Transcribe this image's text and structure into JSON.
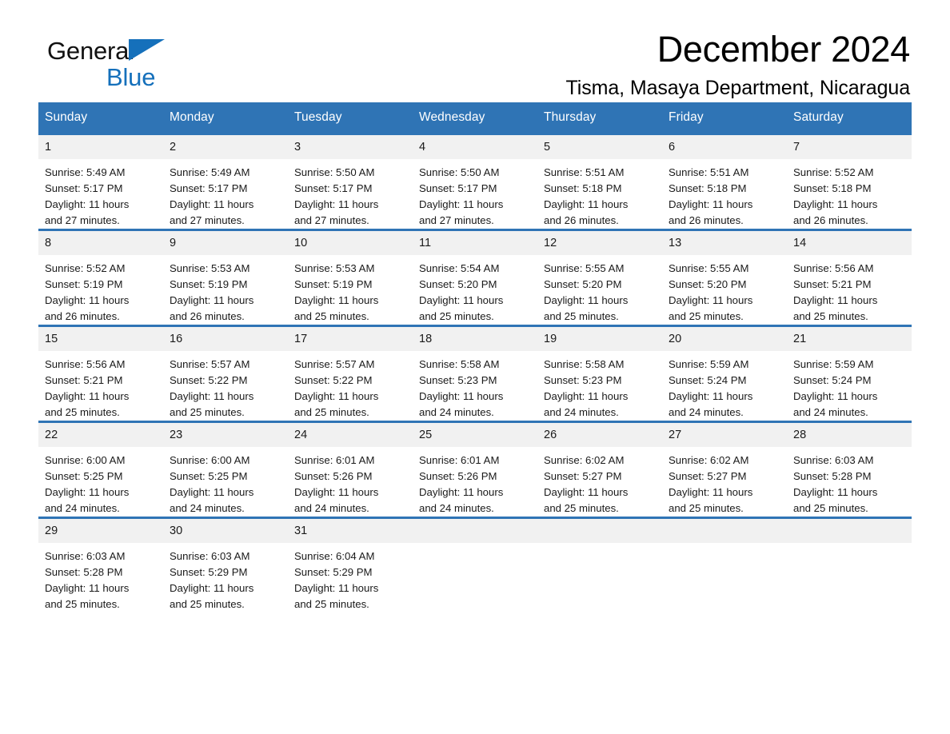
{
  "brand": {
    "name_part1": "General",
    "name_part2": "Blue",
    "triangle_color": "#1570bb"
  },
  "header": {
    "title": "December 2024",
    "subtitle": "Tisma, Masaya Department, Nicaragua",
    "accent_color": "#2f74b5",
    "daynum_band_color": "#f1f1f1"
  },
  "weekday_headers": [
    "Sunday",
    "Monday",
    "Tuesday",
    "Wednesday",
    "Thursday",
    "Friday",
    "Saturday"
  ],
  "weeks": [
    [
      {
        "day": "1",
        "sunrise": "Sunrise: 5:49 AM",
        "sunset": "Sunset: 5:17 PM",
        "daylight_line1": "Daylight: 11 hours",
        "daylight_line2": "and 27 minutes."
      },
      {
        "day": "2",
        "sunrise": "Sunrise: 5:49 AM",
        "sunset": "Sunset: 5:17 PM",
        "daylight_line1": "Daylight: 11 hours",
        "daylight_line2": "and 27 minutes."
      },
      {
        "day": "3",
        "sunrise": "Sunrise: 5:50 AM",
        "sunset": "Sunset: 5:17 PM",
        "daylight_line1": "Daylight: 11 hours",
        "daylight_line2": "and 27 minutes."
      },
      {
        "day": "4",
        "sunrise": "Sunrise: 5:50 AM",
        "sunset": "Sunset: 5:17 PM",
        "daylight_line1": "Daylight: 11 hours",
        "daylight_line2": "and 27 minutes."
      },
      {
        "day": "5",
        "sunrise": "Sunrise: 5:51 AM",
        "sunset": "Sunset: 5:18 PM",
        "daylight_line1": "Daylight: 11 hours",
        "daylight_line2": "and 26 minutes."
      },
      {
        "day": "6",
        "sunrise": "Sunrise: 5:51 AM",
        "sunset": "Sunset: 5:18 PM",
        "daylight_line1": "Daylight: 11 hours",
        "daylight_line2": "and 26 minutes."
      },
      {
        "day": "7",
        "sunrise": "Sunrise: 5:52 AM",
        "sunset": "Sunset: 5:18 PM",
        "daylight_line1": "Daylight: 11 hours",
        "daylight_line2": "and 26 minutes."
      }
    ],
    [
      {
        "day": "8",
        "sunrise": "Sunrise: 5:52 AM",
        "sunset": "Sunset: 5:19 PM",
        "daylight_line1": "Daylight: 11 hours",
        "daylight_line2": "and 26 minutes."
      },
      {
        "day": "9",
        "sunrise": "Sunrise: 5:53 AM",
        "sunset": "Sunset: 5:19 PM",
        "daylight_line1": "Daylight: 11 hours",
        "daylight_line2": "and 26 minutes."
      },
      {
        "day": "10",
        "sunrise": "Sunrise: 5:53 AM",
        "sunset": "Sunset: 5:19 PM",
        "daylight_line1": "Daylight: 11 hours",
        "daylight_line2": "and 25 minutes."
      },
      {
        "day": "11",
        "sunrise": "Sunrise: 5:54 AM",
        "sunset": "Sunset: 5:20 PM",
        "daylight_line1": "Daylight: 11 hours",
        "daylight_line2": "and 25 minutes."
      },
      {
        "day": "12",
        "sunrise": "Sunrise: 5:55 AM",
        "sunset": "Sunset: 5:20 PM",
        "daylight_line1": "Daylight: 11 hours",
        "daylight_line2": "and 25 minutes."
      },
      {
        "day": "13",
        "sunrise": "Sunrise: 5:55 AM",
        "sunset": "Sunset: 5:20 PM",
        "daylight_line1": "Daylight: 11 hours",
        "daylight_line2": "and 25 minutes."
      },
      {
        "day": "14",
        "sunrise": "Sunrise: 5:56 AM",
        "sunset": "Sunset: 5:21 PM",
        "daylight_line1": "Daylight: 11 hours",
        "daylight_line2": "and 25 minutes."
      }
    ],
    [
      {
        "day": "15",
        "sunrise": "Sunrise: 5:56 AM",
        "sunset": "Sunset: 5:21 PM",
        "daylight_line1": "Daylight: 11 hours",
        "daylight_line2": "and 25 minutes."
      },
      {
        "day": "16",
        "sunrise": "Sunrise: 5:57 AM",
        "sunset": "Sunset: 5:22 PM",
        "daylight_line1": "Daylight: 11 hours",
        "daylight_line2": "and 25 minutes."
      },
      {
        "day": "17",
        "sunrise": "Sunrise: 5:57 AM",
        "sunset": "Sunset: 5:22 PM",
        "daylight_line1": "Daylight: 11 hours",
        "daylight_line2": "and 25 minutes."
      },
      {
        "day": "18",
        "sunrise": "Sunrise: 5:58 AM",
        "sunset": "Sunset: 5:23 PM",
        "daylight_line1": "Daylight: 11 hours",
        "daylight_line2": "and 24 minutes."
      },
      {
        "day": "19",
        "sunrise": "Sunrise: 5:58 AM",
        "sunset": "Sunset: 5:23 PM",
        "daylight_line1": "Daylight: 11 hours",
        "daylight_line2": "and 24 minutes."
      },
      {
        "day": "20",
        "sunrise": "Sunrise: 5:59 AM",
        "sunset": "Sunset: 5:24 PM",
        "daylight_line1": "Daylight: 11 hours",
        "daylight_line2": "and 24 minutes."
      },
      {
        "day": "21",
        "sunrise": "Sunrise: 5:59 AM",
        "sunset": "Sunset: 5:24 PM",
        "daylight_line1": "Daylight: 11 hours",
        "daylight_line2": "and 24 minutes."
      }
    ],
    [
      {
        "day": "22",
        "sunrise": "Sunrise: 6:00 AM",
        "sunset": "Sunset: 5:25 PM",
        "daylight_line1": "Daylight: 11 hours",
        "daylight_line2": "and 24 minutes."
      },
      {
        "day": "23",
        "sunrise": "Sunrise: 6:00 AM",
        "sunset": "Sunset: 5:25 PM",
        "daylight_line1": "Daylight: 11 hours",
        "daylight_line2": "and 24 minutes."
      },
      {
        "day": "24",
        "sunrise": "Sunrise: 6:01 AM",
        "sunset": "Sunset: 5:26 PM",
        "daylight_line1": "Daylight: 11 hours",
        "daylight_line2": "and 24 minutes."
      },
      {
        "day": "25",
        "sunrise": "Sunrise: 6:01 AM",
        "sunset": "Sunset: 5:26 PM",
        "daylight_line1": "Daylight: 11 hours",
        "daylight_line2": "and 24 minutes."
      },
      {
        "day": "26",
        "sunrise": "Sunrise: 6:02 AM",
        "sunset": "Sunset: 5:27 PM",
        "daylight_line1": "Daylight: 11 hours",
        "daylight_line2": "and 25 minutes."
      },
      {
        "day": "27",
        "sunrise": "Sunrise: 6:02 AM",
        "sunset": "Sunset: 5:27 PM",
        "daylight_line1": "Daylight: 11 hours",
        "daylight_line2": "and 25 minutes."
      },
      {
        "day": "28",
        "sunrise": "Sunrise: 6:03 AM",
        "sunset": "Sunset: 5:28 PM",
        "daylight_line1": "Daylight: 11 hours",
        "daylight_line2": "and 25 minutes."
      }
    ],
    [
      {
        "day": "29",
        "sunrise": "Sunrise: 6:03 AM",
        "sunset": "Sunset: 5:28 PM",
        "daylight_line1": "Daylight: 11 hours",
        "daylight_line2": "and 25 minutes."
      },
      {
        "day": "30",
        "sunrise": "Sunrise: 6:03 AM",
        "sunset": "Sunset: 5:29 PM",
        "daylight_line1": "Daylight: 11 hours",
        "daylight_line2": "and 25 minutes."
      },
      {
        "day": "31",
        "sunrise": "Sunrise: 6:04 AM",
        "sunset": "Sunset: 5:29 PM",
        "daylight_line1": "Daylight: 11 hours",
        "daylight_line2": "and 25 minutes."
      },
      {
        "day": "",
        "sunrise": "",
        "sunset": "",
        "daylight_line1": "",
        "daylight_line2": ""
      },
      {
        "day": "",
        "sunrise": "",
        "sunset": "",
        "daylight_line1": "",
        "daylight_line2": ""
      },
      {
        "day": "",
        "sunrise": "",
        "sunset": "",
        "daylight_line1": "",
        "daylight_line2": ""
      },
      {
        "day": "",
        "sunrise": "",
        "sunset": "",
        "daylight_line1": "",
        "daylight_line2": ""
      }
    ]
  ]
}
